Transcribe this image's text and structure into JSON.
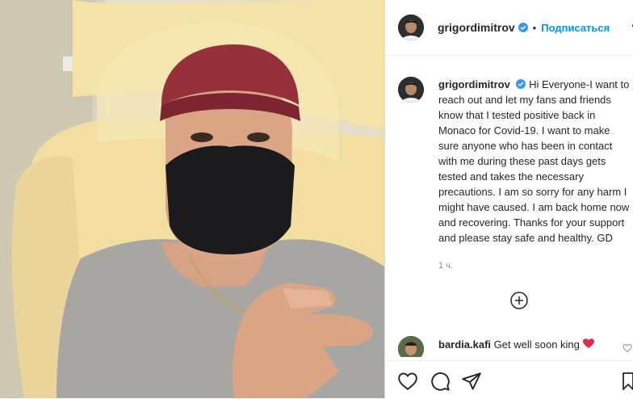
{
  "post": {
    "username": "grigordimitrov",
    "follow_label": "Подписаться",
    "more_label": "•",
    "caption": "Hi Everyone-I want to reach out and let my fans and friends know that I tested positive back in Monaco for Covid-19. I want to make sure anyone who has been in contact with me during these past days gets tested and takes the necessary precautions. I am so sorry for any harm I might have caused. I am back home now and recovering. Thanks for your support and please stay safe and healthy. GD",
    "time": "1 ч."
  },
  "comments": [
    {
      "username": "bardia.kafi",
      "text": "Get well soon king"
    }
  ],
  "icons": {
    "verified": "verified-badge-icon",
    "load_more": "plus-circle-icon",
    "like": "heart-icon",
    "comment": "comment-icon",
    "share": "send-icon",
    "save": "bookmark-icon"
  },
  "colors": {
    "accent": "#0095f6",
    "verified": "#3897f0",
    "heart": "#ed4956"
  }
}
